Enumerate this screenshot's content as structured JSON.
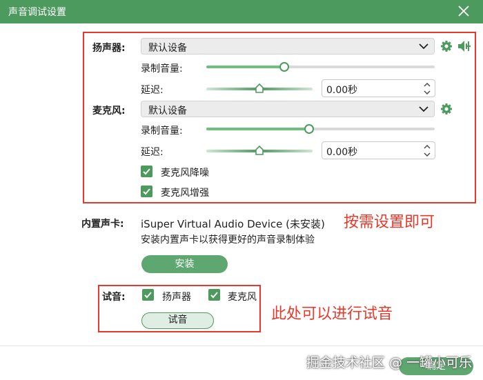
{
  "window": {
    "title": "声音调试设置"
  },
  "speaker": {
    "label": "扬声器:",
    "device": "默认设备",
    "volume_label": "录制音量:",
    "volume_fraction": 0.34,
    "delay_label": "延迟:",
    "delay_fraction": 0.5,
    "delay_value": "0.00秒"
  },
  "microphone": {
    "label": "麦克风:",
    "device": "默认设备",
    "volume_label": "录制音量:",
    "volume_fraction": 0.45,
    "delay_label": "延迟:",
    "delay_fraction": 0.5,
    "delay_value": "0.00秒",
    "noise_reduction": {
      "label": "麦克风降噪",
      "checked": true
    },
    "enhance": {
      "label": "麦克风增强",
      "checked": true
    }
  },
  "builtin_card": {
    "label": "内置声卡:",
    "device_name": "iSuper Virtual Audio Device (未安装)",
    "hint": "安装内置声卡以获得更好的声音录制体验",
    "install_button": "安装"
  },
  "test": {
    "label": "试音:",
    "speaker": {
      "label": "扬声器",
      "checked": true
    },
    "microphone": {
      "label": "麦克风",
      "checked": true
    },
    "button": "试音"
  },
  "ok_button": "确定",
  "annotations": {
    "settings_note": "按需设置即可",
    "test_note": "此处可以进行试音"
  },
  "watermark": "掘金技术社区 @ 一罐小可乐",
  "colors": {
    "accent": "#4c9a5e",
    "annotation_red": "#e8382b"
  }
}
